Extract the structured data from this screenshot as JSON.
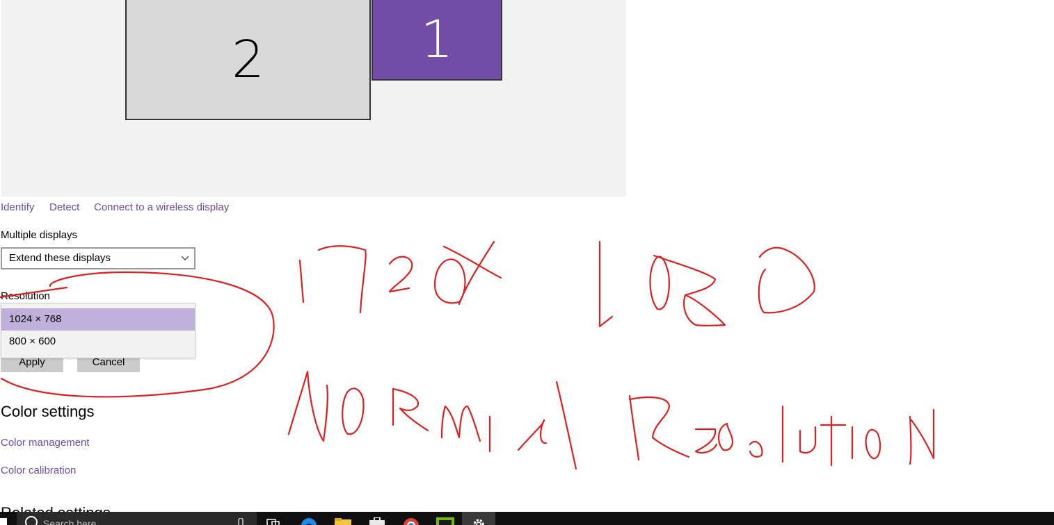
{
  "display_arrangement": {
    "monitors": [
      {
        "label": "2",
        "color": "#d9d9d9"
      },
      {
        "label": "1",
        "color": "#744da9"
      }
    ]
  },
  "links": {
    "identify": "Identify",
    "detect": "Detect",
    "wireless": "Connect to a wireless display"
  },
  "multiple_displays": {
    "label": "Multiple displays",
    "selected": "Extend these displays"
  },
  "resolution": {
    "label": "Resolution",
    "options": [
      "1024 × 768",
      "800 × 600"
    ],
    "selected_index": 0
  },
  "buttons": {
    "apply": "Apply",
    "cancel": "Cancel"
  },
  "color_settings": {
    "heading": "Color settings",
    "management": "Color management",
    "calibration": "Color calibration"
  },
  "related_settings": {
    "heading": "Related settings"
  },
  "taskbar": {
    "search_placeholder": "Search here",
    "icons": [
      "start-icon",
      "search-icon",
      "microphone-icon",
      "task-view-icon",
      "edge-icon",
      "file-explorer-icon",
      "store-icon",
      "chrome-icon",
      "nvidia-icon",
      "settings-icon"
    ]
  },
  "annotation": {
    "line1": "1920x 1080",
    "line2": "Normal Resolution",
    "color": "#e02020"
  }
}
